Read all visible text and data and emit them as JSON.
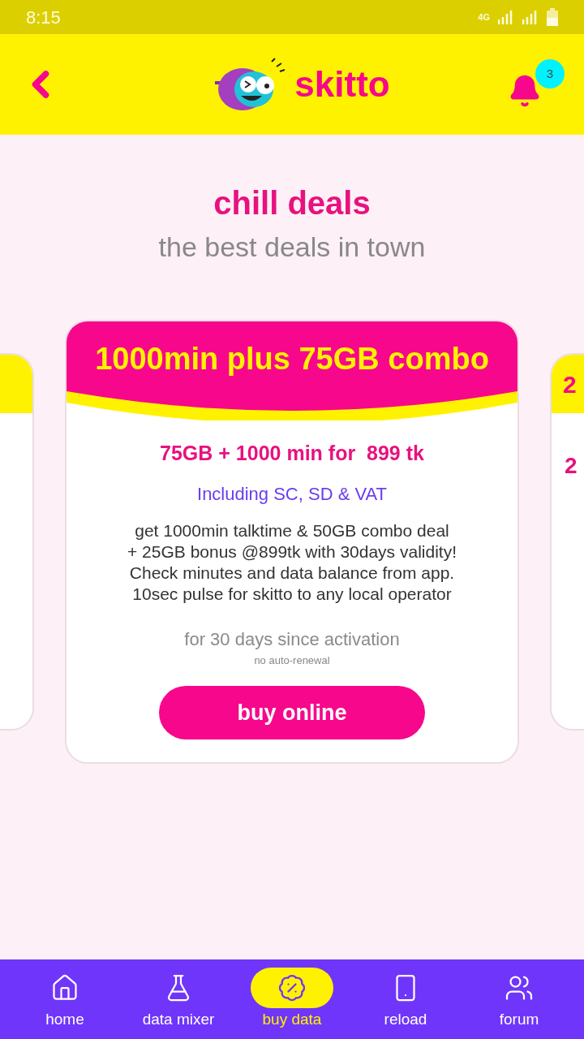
{
  "status_bar": {
    "time": "8:15",
    "network": "4G"
  },
  "header": {
    "brand": "skitto",
    "notification_count": "3"
  },
  "hero": {
    "title": "chill deals",
    "subtitle": "the best deals in town"
  },
  "deals": [
    {
      "kind": "peek_left"
    },
    {
      "kind": "main",
      "title": "1000min plus 75GB combo",
      "price_line": "75GB + 1000 min for  899 tk",
      "tax_note": "Including SC, SD & VAT",
      "description": "get 1000min talktime & 50GB combo deal\n+ 25GB bonus @899tk with 30days validity!\nCheck minutes and data balance from app.\n10sec pulse for skitto to any local operator",
      "validity": "for 30 days since activation",
      "renewal": "no auto-renewal",
      "button": "buy online"
    },
    {
      "kind": "peek_right",
      "title": "2",
      "price_line": "2"
    }
  ],
  "nav": [
    {
      "label": "home",
      "selected": false
    },
    {
      "label": "data mixer",
      "selected": false
    },
    {
      "label": "buy data",
      "selected": true
    },
    {
      "label": "reload",
      "selected": false
    },
    {
      "label": "forum",
      "selected": false
    }
  ]
}
